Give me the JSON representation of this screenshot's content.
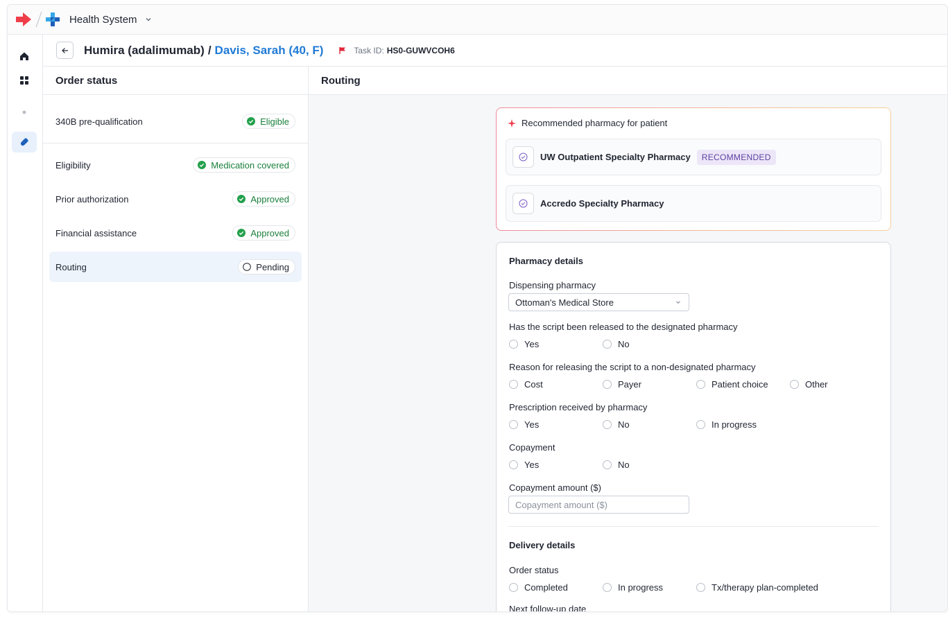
{
  "app": {
    "org_name": "Health System"
  },
  "header": {
    "drug": "Humira (adalimumab)",
    "separator": "/",
    "patient": "Davis, Sarah (40, F)",
    "task_label": "Task ID:",
    "task_id": "HS0-GUWVCOH6"
  },
  "order_status": {
    "title": "Order status",
    "items": [
      {
        "label": "340B pre-qualification",
        "status": "Eligible",
        "state": "ok"
      },
      {
        "label": "Eligibility",
        "status": "Medication covered",
        "state": "ok"
      },
      {
        "label": "Prior authorization",
        "status": "Approved",
        "state": "ok"
      },
      {
        "label": "Financial assistance",
        "status": "Approved",
        "state": "ok"
      },
      {
        "label": "Routing",
        "status": "Pending",
        "state": "pending"
      }
    ]
  },
  "routing": {
    "title": "Routing",
    "recommended": {
      "title": "Recommended pharmacy for patient",
      "options": [
        {
          "name": "UW Outpatient Specialty Pharmacy",
          "badge": "RECOMMENDED"
        },
        {
          "name": "Accredo Specialty Pharmacy",
          "badge": ""
        }
      ]
    },
    "pharmacy_details": {
      "title": "Pharmacy details",
      "dispensing_label": "Dispensing pharmacy",
      "dispensing_value": "Ottoman's Medical Store",
      "script_released_label": "Has the script been released to the designated pharmacy",
      "script_released_options": [
        "Yes",
        "No"
      ],
      "reason_label": "Reason for releasing the script to a non-designated pharmacy",
      "reason_options": [
        "Cost",
        "Payer",
        "Patient choice",
        "Other"
      ],
      "rx_received_label": "Prescription received by pharmacy",
      "rx_received_options": [
        "Yes",
        "No",
        "In progress"
      ],
      "copayment_label": "Copayment",
      "copayment_options": [
        "Yes",
        "No"
      ],
      "copay_amount_label": "Copayment amount ($)",
      "copay_amount_placeholder": "Copayment amount ($)"
    },
    "delivery_details": {
      "title": "Delivery details",
      "order_status_label": "Order status",
      "order_status_options": [
        "Completed",
        "In progress",
        "Tx/therapy plan-completed"
      ],
      "next_followup_label": "Next follow-up date"
    }
  },
  "colors": {
    "brand_red": "#ef3e4a",
    "brand_blue": "#1f7ad6",
    "success": "#1a7f3c",
    "badge_purple": "#5b3fa0"
  }
}
